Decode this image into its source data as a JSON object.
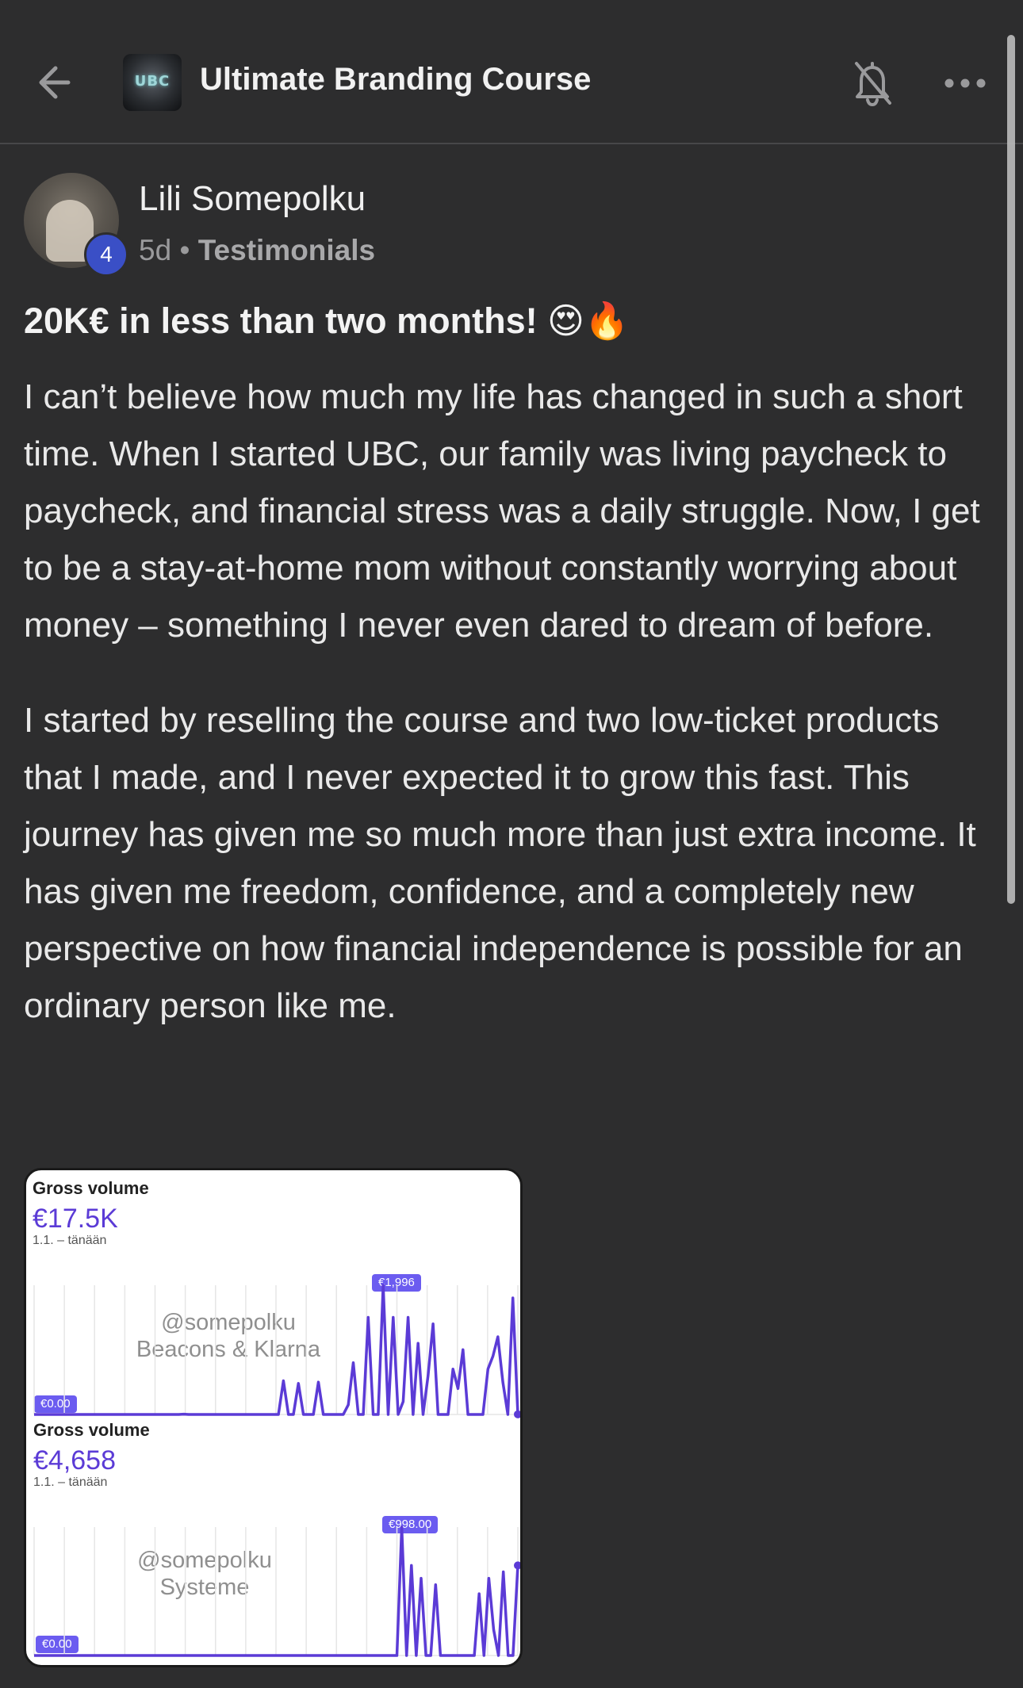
{
  "header": {
    "title": "Ultimate Branding Course",
    "logo_text": "UBC",
    "back_icon": "arrow-left-icon",
    "bell_icon": "bell-off-icon",
    "more_icon": "more-horizontal-icon"
  },
  "post": {
    "author": "Lili Somepolku",
    "level": "4",
    "time": "5d",
    "separator": "•",
    "category": "Testimonials",
    "title": "20K€ in less than two months! 😍🔥",
    "paragraphs": [
      "I can’t believe how much my life has changed in such a short time. When I started UBC, our family was living paycheck to paycheck, and financial stress was a daily struggle. Now, I get to be a stay-at-home mom without constantly worrying about money – something I never even dared to dream of before.",
      "I started by reselling the course and two low-ticket products that I made, and I never expected it to grow this fast. This journey has given me so much more than just extra income. It has given me freedom, confidence, and a completely new perspective on how financial independence is possible for an ordinary person like me."
    ]
  },
  "colors": {
    "background": "#2d2d2e",
    "accent": "#5b3bd6",
    "level_badge": "#3a4fc6"
  },
  "chart_data": [
    {
      "type": "line",
      "title": "Gross volume",
      "total": "€17.5K",
      "range": "1.1. – tänään",
      "watermark": [
        "@somepolku",
        "Beacons & Klarna"
      ],
      "min_label": "€0.00",
      "max_label": "€1,996",
      "ylim": [
        0,
        1996
      ],
      "grid": true,
      "values": [
        0,
        0,
        0,
        0,
        0,
        0,
        0,
        0,
        0,
        0,
        0,
        0,
        0,
        0,
        0,
        0,
        0,
        0,
        0,
        0,
        0,
        0,
        0,
        0,
        0,
        0,
        0,
        0,
        0,
        0,
        5,
        0,
        0,
        0,
        0,
        0,
        0,
        0,
        0,
        0,
        0,
        0,
        0,
        0,
        0,
        0,
        0,
        0,
        0,
        0,
        520,
        0,
        0,
        480,
        0,
        0,
        0,
        500,
        0,
        0,
        0,
        0,
        0,
        150,
        800,
        0,
        0,
        1500,
        0,
        0,
        1996,
        0,
        1500,
        0,
        200,
        1500,
        0,
        1100,
        0,
        600,
        1400,
        0,
        0,
        0,
        700,
        400,
        1000,
        0,
        0,
        0,
        0,
        700,
        900,
        1200,
        500,
        0,
        1800,
        2
      ]
    },
    {
      "type": "line",
      "title": "Gross volume",
      "total": "€4,658",
      "range": "1.1. – tänään",
      "watermark": [
        "@somepolku",
        "Systeme"
      ],
      "min_label": "€0.00",
      "max_label": "€998.00",
      "ylim": [
        0,
        998
      ],
      "grid": true,
      "values": [
        0,
        0,
        0,
        0,
        0,
        0,
        0,
        0,
        0,
        0,
        0,
        0,
        0,
        0,
        0,
        0,
        0,
        0,
        0,
        0,
        0,
        0,
        0,
        0,
        0,
        0,
        0,
        0,
        0,
        0,
        0,
        0,
        0,
        0,
        0,
        0,
        0,
        0,
        0,
        0,
        0,
        0,
        0,
        0,
        0,
        0,
        0,
        0,
        0,
        0,
        0,
        0,
        0,
        0,
        0,
        0,
        0,
        0,
        0,
        0,
        0,
        0,
        0,
        0,
        0,
        0,
        0,
        0,
        0,
        0,
        0,
        0,
        0,
        0,
        0,
        0,
        998,
        0,
        700,
        0,
        600,
        0,
        0,
        550,
        0,
        0,
        0,
        0,
        0,
        0,
        0,
        0,
        480,
        0,
        600,
        200,
        0,
        650,
        0,
        0,
        700
      ]
    }
  ]
}
